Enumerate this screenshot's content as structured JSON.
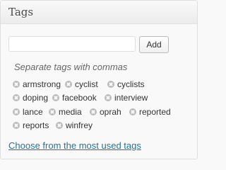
{
  "panel": {
    "title": "Tags",
    "input_value": "",
    "add_label": "Add",
    "hint": "Separate tags with commas"
  },
  "tags": [
    "armstrong",
    "cyclist",
    "cyclists",
    "doping",
    "facebook",
    "interview",
    "lance",
    "media",
    "oprah",
    "reported",
    "reports",
    "winfrey"
  ],
  "most_used_link": "Choose from the most used tags",
  "colors": {
    "link": "#21759b",
    "remove_icon": "#bbbbbb"
  }
}
